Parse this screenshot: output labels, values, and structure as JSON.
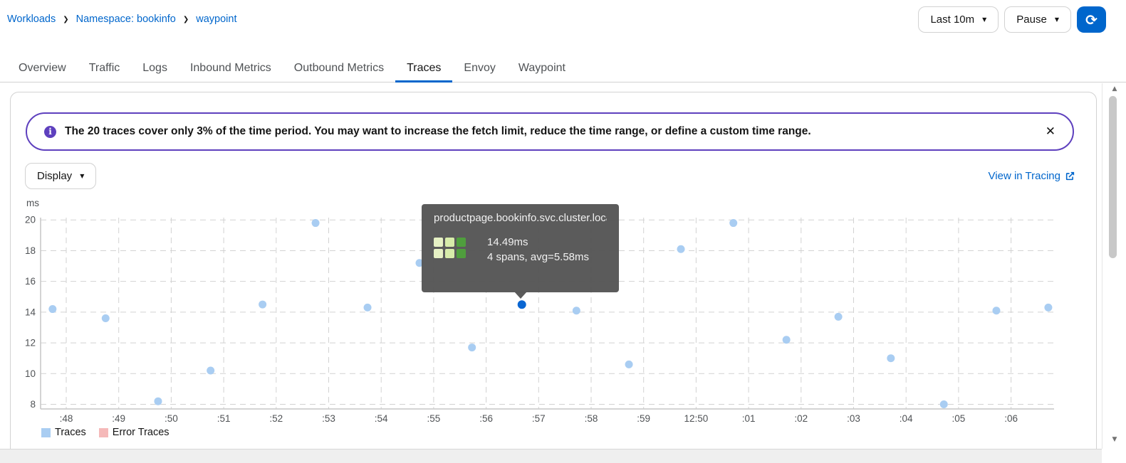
{
  "breadcrumb": {
    "items": [
      "Workloads",
      "Namespace: bookinfo",
      "waypoint"
    ]
  },
  "toolbar": {
    "duration": "Last 10m",
    "refresh_mode": "Pause"
  },
  "tabs": {
    "items": [
      "Overview",
      "Traffic",
      "Logs",
      "Inbound Metrics",
      "Outbound Metrics",
      "Traces",
      "Envoy",
      "Waypoint"
    ],
    "active": "Traces"
  },
  "alert": {
    "text": "The 20 traces cover only 3% of the time period. You may want to increase the fetch limit, reduce the time range, or define a custom time range."
  },
  "chart_controls": {
    "display": "Display",
    "view_in_tracing": "View in Tracing"
  },
  "tooltip": {
    "title": "productpage.bookinfo.svc.cluster.local:...",
    "duration": "14.49ms",
    "detail": "4 spans, avg=5.58ms",
    "heatmap_colors": [
      [
        "#e6f1c4",
        "#d7ecaa",
        "#4f9e3d"
      ],
      [
        "#e6f1c4",
        "#d7ecaa",
        "#4f9e3d"
      ]
    ]
  },
  "chart_data": {
    "type": "scatter",
    "title": "",
    "xlabel": "",
    "ylabel": "ms",
    "y_ticks": [
      20,
      18,
      16,
      14,
      12,
      10,
      8
    ],
    "ylim": [
      7.7,
      20.15
    ],
    "x_tick_labels": [
      ":48",
      ":49",
      ":50",
      ":51",
      ":52",
      ":53",
      ":54",
      ":55",
      ":56",
      ":57",
      ":58",
      ":59",
      "12:50",
      ":01",
      ":02",
      ":03",
      ":04",
      ":05",
      ":06"
    ],
    "x_unit": "minutes offset from :48 tick",
    "grid": "dashed",
    "legend_position": "bottom-left",
    "series": [
      {
        "name": "Traces",
        "color": "#a9cdf2",
        "points": [
          {
            "x": -0.26,
            "y": 14.2
          },
          {
            "x": 0.75,
            "y": 13.6
          },
          {
            "x": 1.75,
            "y": 8.2
          },
          {
            "x": 2.75,
            "y": 10.2
          },
          {
            "x": 3.74,
            "y": 14.5
          },
          {
            "x": 4.75,
            "y": 19.8
          },
          {
            "x": 5.74,
            "y": 14.3
          },
          {
            "x": 6.73,
            "y": 17.2
          },
          {
            "x": 7.73,
            "y": 11.7
          },
          {
            "x": 8.68,
            "y": 14.49
          },
          {
            "x": 9.72,
            "y": 14.1
          },
          {
            "x": 10.72,
            "y": 10.6
          },
          {
            "x": 11.71,
            "y": 18.1
          },
          {
            "x": 12.71,
            "y": 19.8
          },
          {
            "x": 13.72,
            "y": 12.2
          },
          {
            "x": 14.71,
            "y": 13.7
          },
          {
            "x": 15.71,
            "y": 11.0
          },
          {
            "x": 16.72,
            "y": 8.0
          },
          {
            "x": 17.72,
            "y": 14.1
          },
          {
            "x": 18.71,
            "y": 14.3
          }
        ]
      },
      {
        "name": "Error Traces",
        "color": "#f5b9b9",
        "points": []
      }
    ],
    "selected": {
      "series": 0,
      "index": 9,
      "color": "#0a66d2"
    }
  },
  "icons": {
    "chevron_right": "❯",
    "caret_down": "▼",
    "sync": "⟳",
    "close": "✕",
    "info": "i",
    "arrow_up": "▲",
    "arrow_down": "▼"
  },
  "colors": {
    "accent": "#0066cc",
    "alert_border": "#5e40be",
    "tooltip_bg": "#565656",
    "grid": "#d2d2d2"
  }
}
